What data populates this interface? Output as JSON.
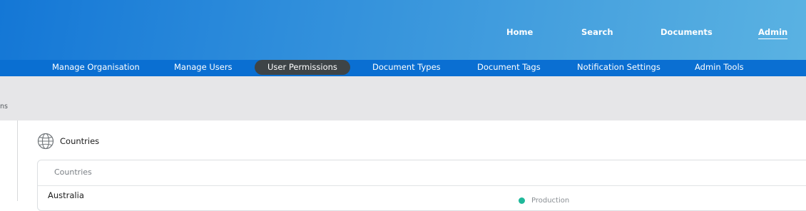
{
  "topnav": {
    "items": [
      {
        "label": "Home"
      },
      {
        "label": "Search"
      },
      {
        "label": "Documents"
      },
      {
        "label": "Admin",
        "active": true
      }
    ]
  },
  "subnav": {
    "items": [
      {
        "label": "Manage Organisation"
      },
      {
        "label": "Manage Users"
      },
      {
        "label": "User Permissions",
        "selected": true
      },
      {
        "label": "Document Types"
      },
      {
        "label": "Document Tags"
      },
      {
        "label": "Notification Settings"
      },
      {
        "label": "Admin Tools"
      }
    ]
  },
  "breadcrumb": {
    "text": "ns"
  },
  "section": {
    "icon": "globe-icon",
    "title": "Countries"
  },
  "panel": {
    "header": "Countries",
    "rows": [
      {
        "name": "Australia",
        "status": "Production"
      }
    ]
  },
  "colors": {
    "topbar_start": "#1477d6",
    "topbar_end": "#5ab2e2",
    "subnav_bg": "#0a6fd2",
    "selected_pill": "#3e4447",
    "status_green": "#1fb89a"
  }
}
